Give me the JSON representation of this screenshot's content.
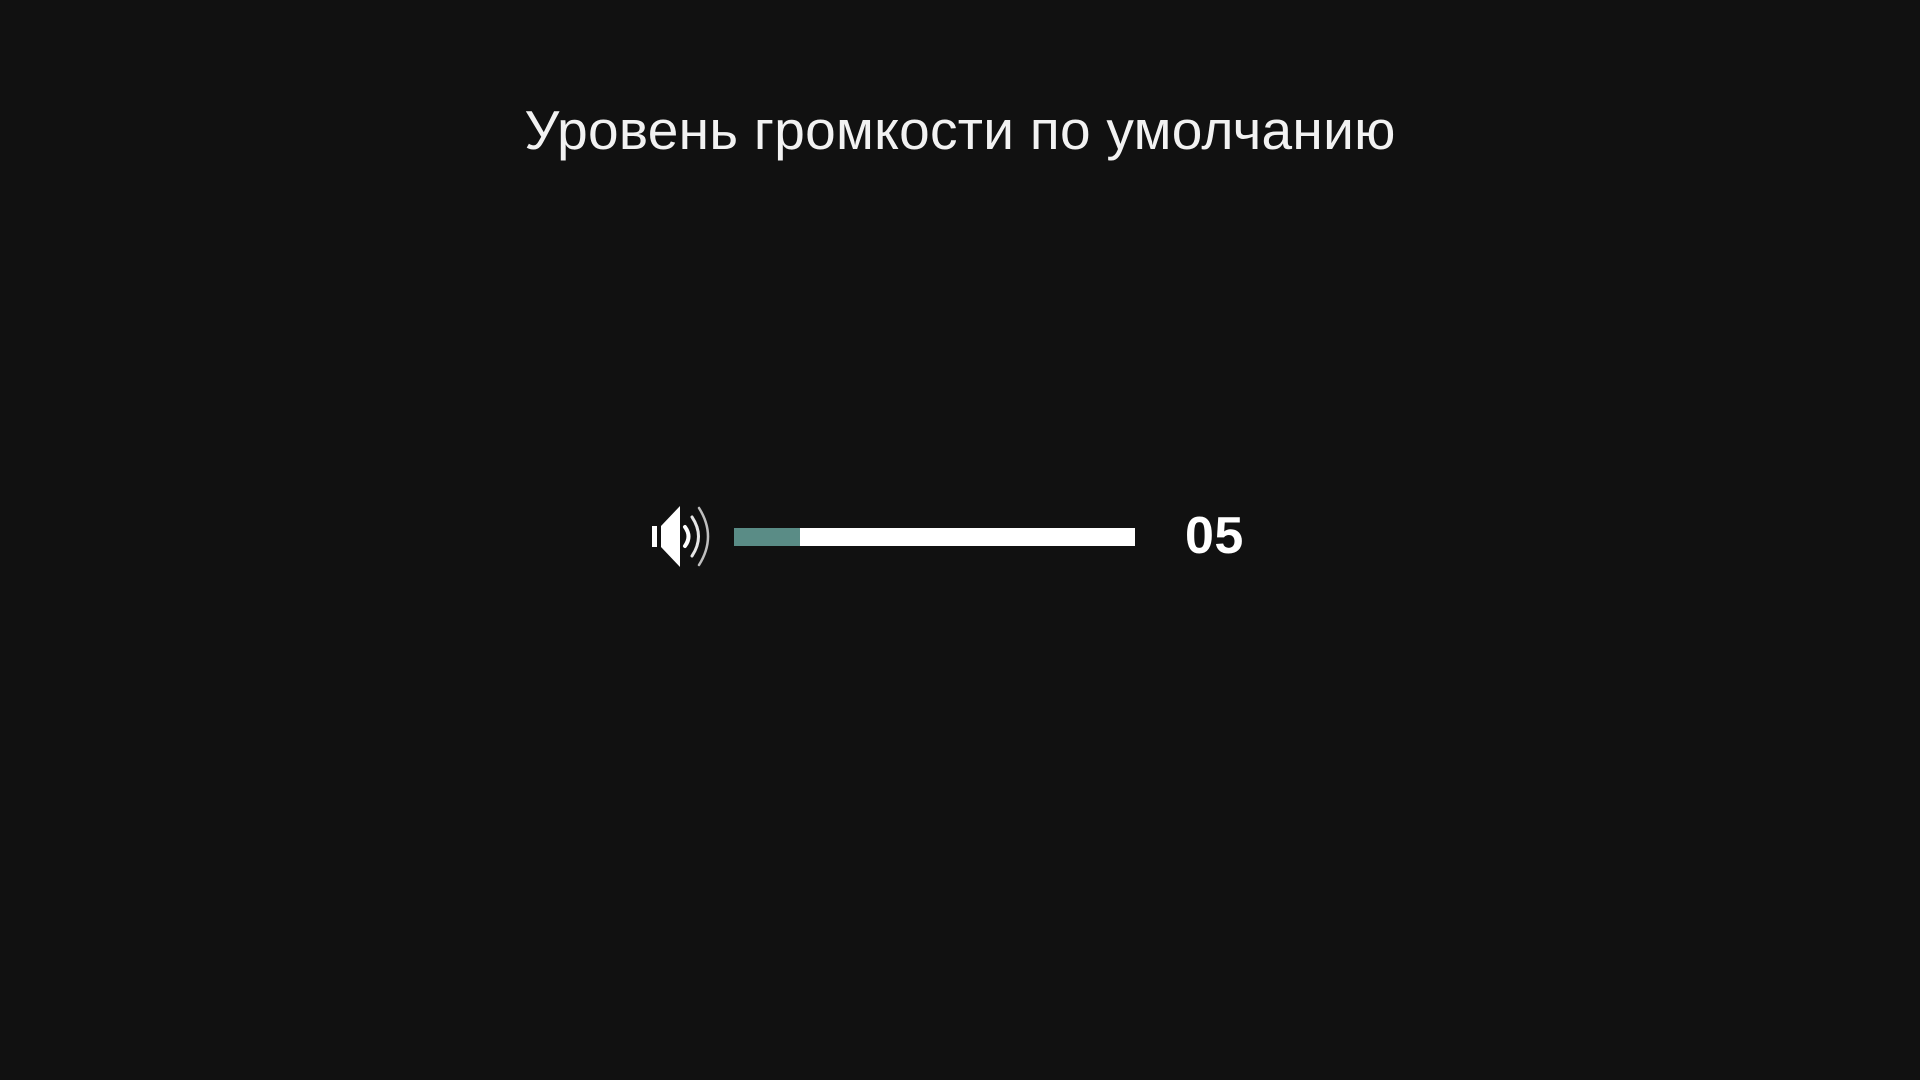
{
  "screen": {
    "title": "Уровень громкости по умолчанию"
  },
  "volume": {
    "icon": "speaker-volume-icon",
    "value_label": "05",
    "level": 0.165,
    "colors": {
      "fill": "#5a8c86",
      "track": "#ffffff",
      "background": "#111111"
    }
  }
}
